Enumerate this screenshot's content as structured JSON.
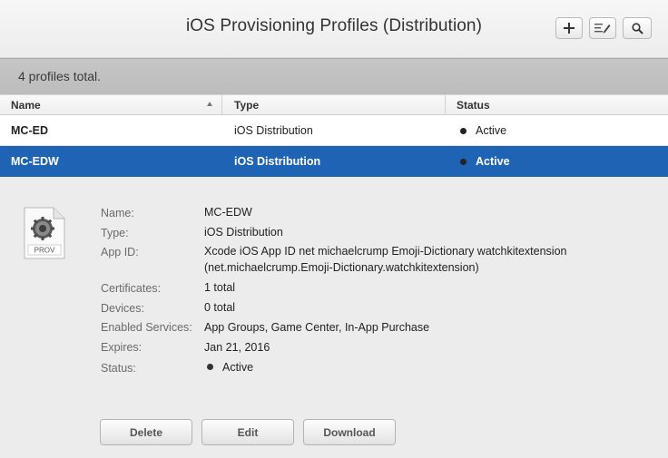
{
  "window": {
    "title": "iOS Provisioning Profiles (Distribution)"
  },
  "toolbar": {
    "add_icon": "plus-icon",
    "edit_icon": "edit-icon",
    "search_icon": "search-icon"
  },
  "summary": {
    "text": "4 profiles total."
  },
  "table": {
    "columns": [
      "Name",
      "Type",
      "Status"
    ],
    "rows": [
      {
        "name": "MC-ED",
        "type": "iOS Distribution",
        "status": "Active",
        "selected": false
      },
      {
        "name": "MC-EDW",
        "type": "iOS Distribution",
        "status": "Active",
        "selected": true
      }
    ]
  },
  "detail": {
    "icon_label": "PROV",
    "labels": {
      "name": "Name:",
      "type": "Type:",
      "app_id": "App ID:",
      "certificates": "Certificates:",
      "devices": "Devices:",
      "enabled_services": "Enabled Services:",
      "expires": "Expires:",
      "status": "Status:"
    },
    "values": {
      "name": "MC-EDW",
      "type": "iOS Distribution",
      "app_id_line1": "Xcode iOS App ID net michaelcrump Emoji-Dictionary watchkitextension",
      "app_id_line2": "(net.michaelcrump.Emoji-Dictionary.watchkitextension)",
      "certificates": "1 total",
      "devices": "0 total",
      "enabled_services": "App Groups, Game Center, In-App Purchase",
      "expires": "Jan 21, 2016",
      "status": "Active"
    }
  },
  "actions": {
    "delete": "Delete",
    "edit": "Edit",
    "download": "Download"
  },
  "colors": {
    "selection": "#1f63b5",
    "summary_bar": "#c2c2c2",
    "background": "#ececec"
  }
}
